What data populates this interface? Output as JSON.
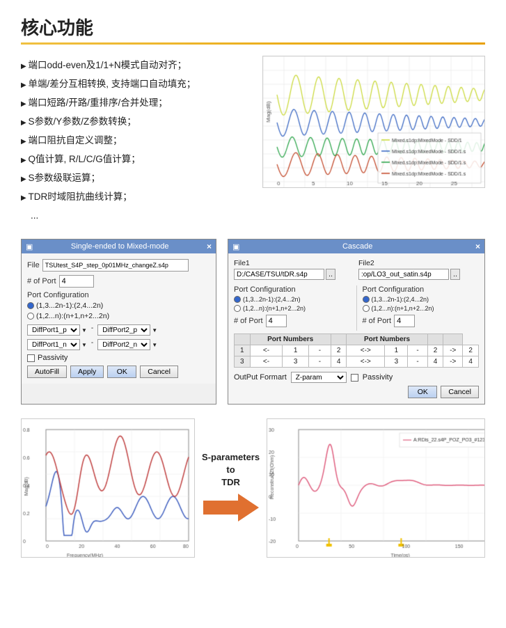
{
  "title": "核心功能",
  "features": [
    "端口odd-even及1/1+N模式自动对齐；",
    "单端/差分互相转换, 支持端口自动填充；",
    "端口短路/开路/重排序/合并处理；",
    "S参数/Y参数/Z参数转换；",
    "端口阻抗自定义调整；",
    "Q值计算, R/L/C/G值计算；",
    "S参数级联运算；",
    "TDR时域阻抗曲线计算；",
    "..."
  ],
  "single_ended_dialog": {
    "title": "Single-ended to Mixed-mode",
    "close": "×",
    "file_label": "File",
    "file_value": "TSUtest_S4P_step_0p01MHz_changeZ.s4p",
    "port_label": "# of Port",
    "port_value": "4",
    "port_config_label": "Port Configuration",
    "radio1": "(1,3...2n-1):(2,4...2n)",
    "radio2": "(1,2...n):(n+1,n+2...2n)",
    "diff1_p": "DiffPort1_p",
    "diff1_n": "DiffPort1_n",
    "diff2_p": "DiffPort2_p",
    "diff2_n": "DiffPort2_n",
    "passivity_label": "Passivity",
    "btn_autofill": "AutoFill",
    "btn_apply": "Apply",
    "btn_ok": "OK",
    "btn_cancel": "Cancel"
  },
  "cascade_dialog": {
    "title": "Cascade",
    "close": "×",
    "file1_label": "File1",
    "file1_value": "D:/CASE/TSU/tDR.s4p",
    "file2_label": "File2",
    "file2_value": ":op/LO3_out_satin.s4p",
    "port_config_label": "Port Configuration",
    "radio1": "(1,3...2n-1):(2,4...2n)",
    "radio2": "(1,2...n):(n+1,n+2...2n)",
    "port_label": "# of Port",
    "port_value_left": "4",
    "port_value_right": "4",
    "port_numbers_label": "Port Numbers",
    "table_rows": [
      {
        "row": "1",
        "left_arrow": "<-",
        "left_from": "1",
        "dash1": "-",
        "left_to": "2",
        "mid_arrow": "<->",
        "right_from": "1",
        "dash2": "-",
        "right_to": "2",
        "right_arrow": "->",
        "right_val": "2"
      },
      {
        "row": "3",
        "left_arrow": "<-",
        "left_from": "3",
        "dash1": "-",
        "left_to": "4",
        "mid_arrow": "<->",
        "right_from": "3",
        "dash2": "-",
        "right_to": "4",
        "right_arrow": "->",
        "right_val": "4"
      }
    ],
    "output_format_label": "OutPut Formart",
    "output_format_value": "Z-param",
    "passivity_label": "Passivity",
    "btn_ok": "OK",
    "btn_cancel": "Cancel"
  },
  "bottom": {
    "arrow_text_line1": "S-parameters",
    "arrow_text_line2": "to",
    "arrow_text_line3": "TDR"
  }
}
